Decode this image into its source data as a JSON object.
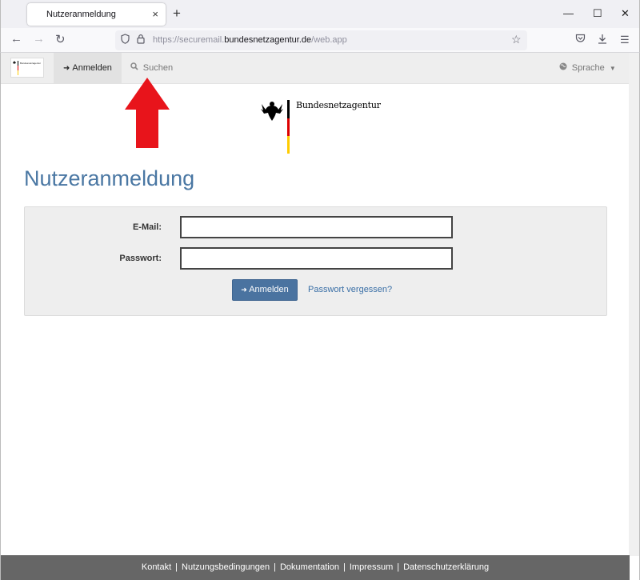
{
  "browser": {
    "tab_title": "Nutzeranmeldung",
    "tab_close": "×",
    "new_tab": "+",
    "url_prefix": "https://securemail.",
    "url_domain": "bundesnetzagentur.de",
    "url_path": "/web.app"
  },
  "app_nav": {
    "logo_text": "Bundesnetzagentur",
    "items": [
      {
        "label": "Anmelden",
        "icon": "sign-in-icon"
      },
      {
        "label": "Suchen",
        "icon": "search-icon"
      }
    ],
    "language": {
      "label": "Sprache",
      "icon": "globe-icon"
    }
  },
  "annotation": {
    "color": "#e8141b",
    "icon": "red-up-arrow"
  },
  "logo": {
    "name": "Bundesnetzagentur",
    "flag_colors": [
      "#000000",
      "#dd0000",
      "#ffcc00"
    ]
  },
  "main": {
    "title": "Nutzeranmeldung",
    "form": {
      "email_label": "E-Mail:",
      "email_value": "",
      "password_label": "Passwort:",
      "password_value": "",
      "submit_label": "Anmelden",
      "forgot_label": "Passwort vergessen?"
    }
  },
  "footer": {
    "links": [
      "Kontakt",
      "Nutzungsbedingungen",
      "Dokumentation",
      "Impressum",
      "Datenschutzerklärung"
    ],
    "separator": "|"
  },
  "colors": {
    "accent": "#4a77a3",
    "button": "#4a73a0",
    "footer_bg": "#666666"
  }
}
